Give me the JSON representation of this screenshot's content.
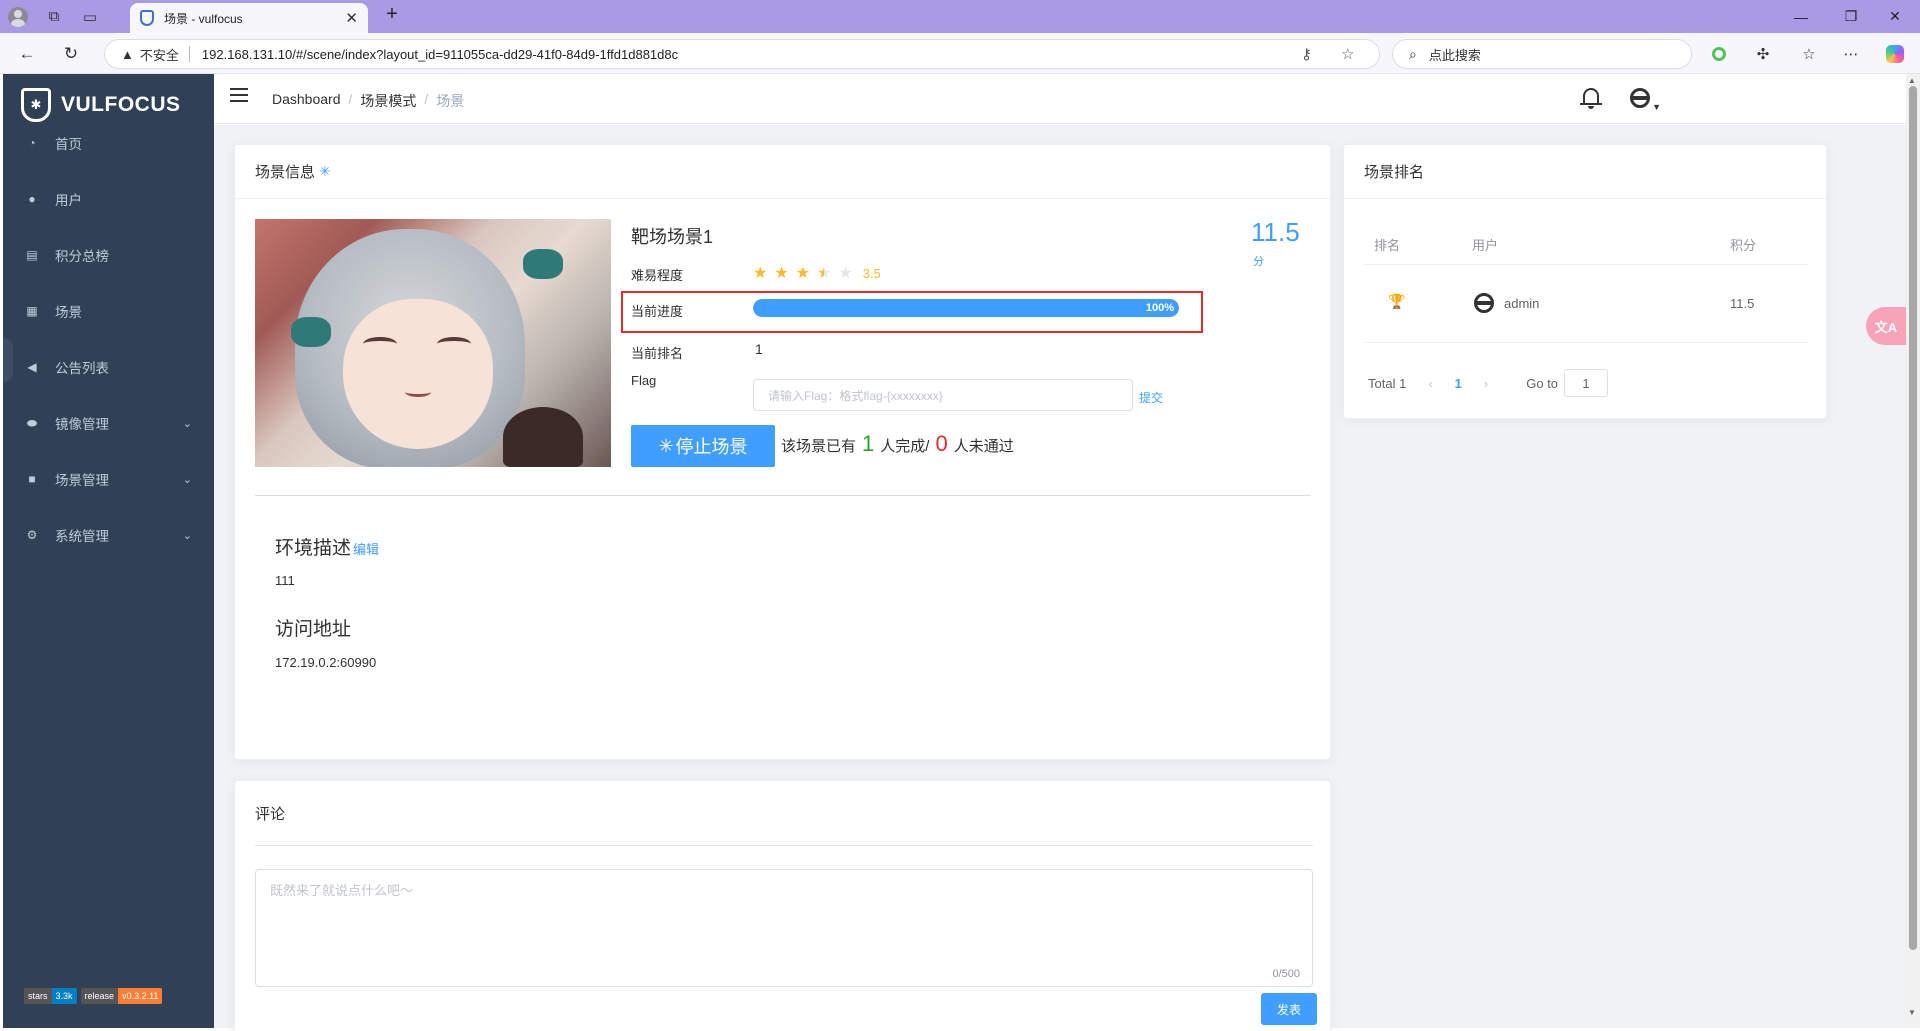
{
  "browser": {
    "tab_title": "场景 - vulfocus",
    "security_label": "不安全",
    "url": "192.168.131.10/#/scene/index?layout_id=911055ca-dd29-41f0-84d9-1ffd1d881d8c",
    "search_placeholder": "点此搜索"
  },
  "sidebar": {
    "logo": "VULFOCUS",
    "items": [
      {
        "label": "首页",
        "icon": "dashboard-icon"
      },
      {
        "label": "用户",
        "icon": "user-icon"
      },
      {
        "label": "积分总榜",
        "icon": "scoreboard-icon"
      },
      {
        "label": "场景",
        "icon": "grid-icon"
      },
      {
        "label": "公告列表",
        "icon": "megaphone-icon"
      },
      {
        "label": "镜像管理",
        "icon": "docker-icon"
      },
      {
        "label": "场景管理",
        "icon": "scene-icon"
      },
      {
        "label": "系统管理",
        "icon": "gear-icon"
      }
    ],
    "badges": {
      "stars_label": "stars",
      "stars_value": "3.3k",
      "release_label": "release",
      "release_value": "v0.3.2.11"
    }
  },
  "header": {
    "breadcrumb": [
      "Dashboard",
      "场景模式",
      "场景"
    ]
  },
  "scene": {
    "card_title": "场景信息",
    "title": "靶场场景1",
    "score": "11.5",
    "score_unit": "分",
    "difficulty_label": "难易程度",
    "difficulty_value": 3.5,
    "difficulty_text": "3.5",
    "progress_label": "当前进度",
    "progress_value": 100,
    "progress_text": "100%",
    "rank_label": "当前排名",
    "rank_value": "1",
    "flag_label": "Flag",
    "flag_placeholder": "请输入Flag：格式flag-{xxxxxxxx}",
    "submit_link": "提交",
    "stop_button": "停止场景",
    "stat_prefix": "该场景已有",
    "stat_done": "1",
    "stat_done_label": "人完成/",
    "stat_fail": "0",
    "stat_fail_label": "人未通过",
    "env_title": "环境描述",
    "env_edit": "编辑",
    "env_value": "111",
    "access_title": "访问地址",
    "access_value": "172.19.0.2:60990"
  },
  "ranking": {
    "card_title": "场景排名",
    "columns": [
      "排名",
      "用户",
      "积分"
    ],
    "rows": [
      {
        "user": "admin",
        "score": "11.5"
      }
    ],
    "total": "Total 1",
    "page": "1",
    "goto_label": "Go to",
    "goto_value": "1"
  },
  "comments": {
    "card_title": "评论",
    "placeholder": "既然来了就说点什么吧～",
    "counter": "0/500",
    "post_button": "发表"
  },
  "colors": {
    "primary": "#409eff",
    "sidebar_bg": "#304156",
    "highlight_box": "#e02d2d",
    "star": "#f7ba2a"
  }
}
